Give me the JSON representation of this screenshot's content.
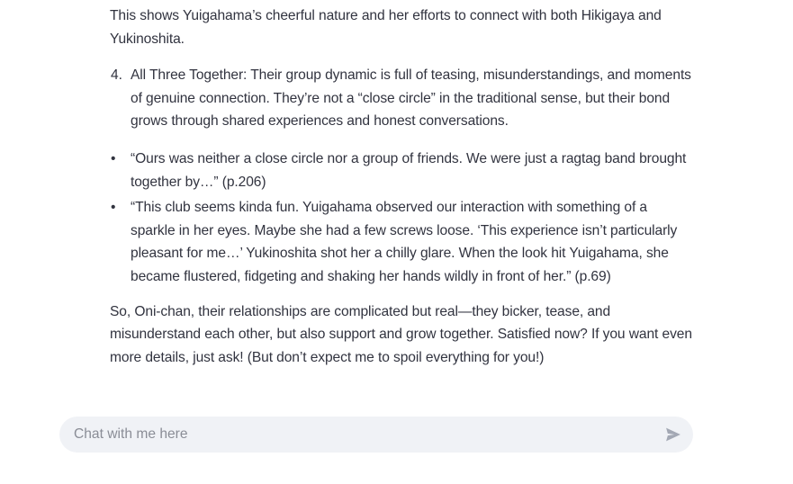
{
  "messages": {
    "intro": "This shows Yuigahama’s cheerful nature and her efforts to connect with both Hikigaya and Yukinoshita.",
    "numbered_item": {
      "number": "4.",
      "text": "All Three Together: Their group dynamic is full of teasing, misunderstandings, and moments of genuine connection. They’re not a “close circle” in the traditional sense, but their bond grows through shared experiences and honest conversations."
    },
    "quotes": [
      "“Ours was neither a close circle nor a group of friends. We were just a ragtag band brought together by…” (p.206)",
      "“This club seems kinda fun. Yuigahama observed our interaction with something of a sparkle in her eyes. Maybe she had a few screws loose. ‘This experience isn’t particularly pleasant for me…’ Yukinoshita shot her a chilly glare. When the look hit Yuigahama, she became flustered, fidgeting and shaking her hands wildly in front of her.” (p.69)"
    ],
    "bullet_glyph": "•",
    "closing": "So, Oni-chan, their relationships are complicated but real—they bicker, tease, and misunderstand each other, but also support and grow together. Satisfied now? If you want even more details, just ask! (But don’t expect me to spoil everything for you!)"
  },
  "chat": {
    "placeholder": "Chat with me here",
    "value": "",
    "send_icon": "send-icon"
  },
  "colors": {
    "text": "#31333f",
    "input_bg": "#f0f2f6",
    "placeholder": "#8a8d96",
    "icon": "#a3a8b4"
  }
}
